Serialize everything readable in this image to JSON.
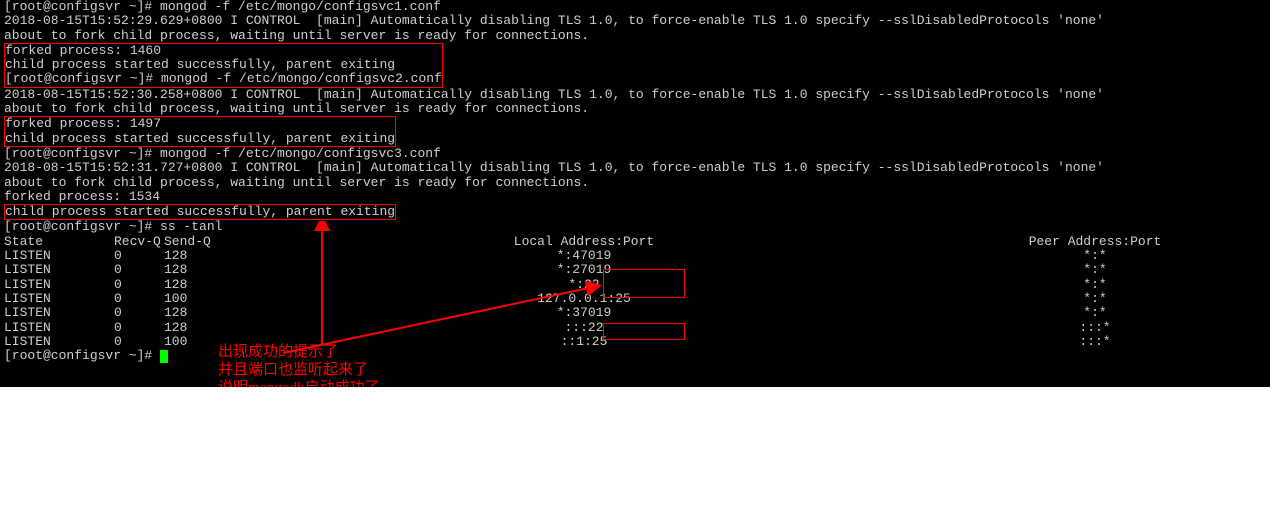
{
  "prompt1": "[root@configsvr ~]# ",
  "cmd1": "mongod -f /etc/mongo/configsvc1.conf",
  "log1a": "2018-08-15T15:52:29.629+0800 I CONTROL  [main] Automatically disabling TLS 1.0, to force-enable TLS 1.0 specify --sslDisabledProtocols 'none'",
  "log1b": "about to fork child process, waiting until server is ready for connections.",
  "log1c": "forked process: 1460",
  "log1d": "child process started successfully, parent exiting",
  "cmd2": "mongod -f /etc/mongo/configsvc2.conf",
  "log2a": "2018-08-15T15:52:30.258+0800 I CONTROL  [main] Automatically disabling TLS 1.0, to force-enable TLS 1.0 specify --sslDisabledProtocols 'none'",
  "log2b": "about to fork child process, waiting until server is ready for connections.",
  "log2c": "forked process: 1497",
  "log2d": "child process started successfully, parent exiting",
  "cmd3": "mongod -f /etc/mongo/configsvc3.conf",
  "log3a": "2018-08-15T15:52:31.727+0800 I CONTROL  [main] Automatically disabling TLS 1.0, to force-enable TLS 1.0 specify --sslDisabledProtocols 'none'",
  "log3b": "about to fork child process, waiting until server is ready for connections.",
  "log3c": "forked process: 1534",
  "log3d": "child process started successfully, parent exiting",
  "cmd4": "ss -tanl",
  "ss": {
    "hdr": {
      "state": "State",
      "recv": "Recv-Q",
      "send": "Send-Q",
      "local": "Local Address:Port",
      "peer": "Peer Address:Port"
    },
    "rows": [
      {
        "state": "LISTEN",
        "recv": "0",
        "send": "128",
        "local": "*:47019",
        "peer": "*:*"
      },
      {
        "state": "LISTEN",
        "recv": "0",
        "send": "128",
        "local": "*:27019",
        "peer": "*:*"
      },
      {
        "state": "LISTEN",
        "recv": "0",
        "send": "128",
        "local": "*:22",
        "peer": "*:*"
      },
      {
        "state": "LISTEN",
        "recv": "0",
        "send": "100",
        "local": "127.0.0.1:25",
        "peer": "*:*"
      },
      {
        "state": "LISTEN",
        "recv": "0",
        "send": "128",
        "local": "*:37019",
        "peer": "*:*"
      },
      {
        "state": "LISTEN",
        "recv": "0",
        "send": "128",
        "local": ":::22",
        "peer": ":::*"
      },
      {
        "state": "LISTEN",
        "recv": "0",
        "send": "100",
        "local": "::1:25",
        "peer": ":::*"
      }
    ]
  },
  "anno1": "出现成功的提示了",
  "anno2": "并且端口也监听起来了",
  "anno3": "说明mongodb启动成功了"
}
